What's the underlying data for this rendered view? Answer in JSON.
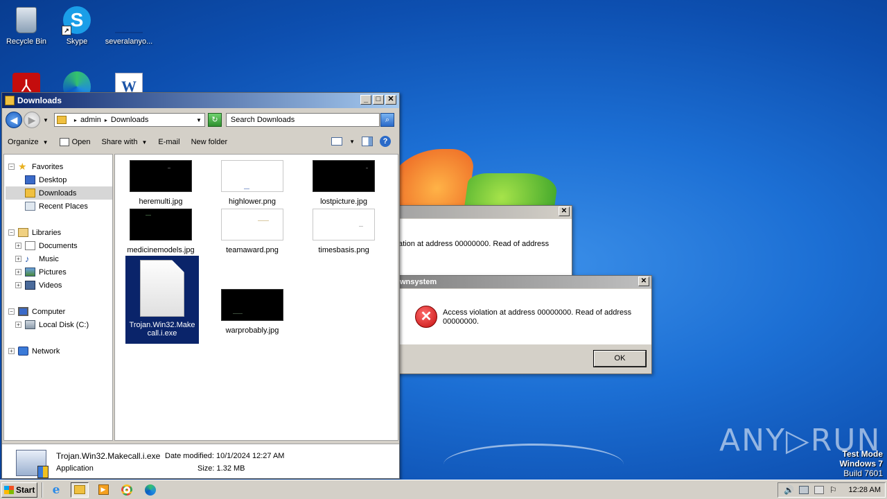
{
  "desktop": {
    "icons_row1": [
      {
        "label": "Recycle Bin",
        "icon": "recycle-bin-icon"
      },
      {
        "label": "Skype",
        "icon": "skype-icon"
      },
      {
        "label": "severalanyo...",
        "icon": "file-icon"
      }
    ],
    "icons_row2": [
      {
        "icon": "acrobat-icon"
      },
      {
        "icon": "edge-icon"
      },
      {
        "icon": "word-icon"
      }
    ],
    "watermark": "ANY▷RUN",
    "test_mode": {
      "line1": "Test Mode",
      "line2": "Windows 7",
      "line3": "Build 7601"
    }
  },
  "explorer": {
    "title": "Downloads",
    "breadcrumb": {
      "root": "admin",
      "current": "Downloads"
    },
    "search_placeholder": "Search Downloads",
    "toolbar": {
      "organize": "Organize",
      "open": "Open",
      "share_with": "Share with",
      "email": "E-mail",
      "new_folder": "New folder"
    },
    "nav": {
      "favorites": "Favorites",
      "desktop": "Desktop",
      "downloads": "Downloads",
      "recent_places": "Recent Places",
      "libraries": "Libraries",
      "documents": "Documents",
      "music": "Music",
      "pictures": "Pictures",
      "videos": "Videos",
      "computer": "Computer",
      "local_disk": "Local Disk (C:)",
      "network": "Network"
    },
    "files": [
      {
        "name": "heremulti.jpg",
        "thumb": "dark"
      },
      {
        "name": "highlower.png",
        "thumb": "light"
      },
      {
        "name": "lostpicture.jpg",
        "thumb": "dark"
      },
      {
        "name": "medicinemodels.jpg",
        "thumb": "dark"
      },
      {
        "name": "teamaward.png",
        "thumb": "light"
      },
      {
        "name": "timesbasis.png",
        "thumb": "light"
      },
      {
        "name": "Trojan.Win32.Makecall.i.exe",
        "name_line1": "Trojan.Win32.Make",
        "name_line2": "call.i.exe",
        "thumb": "document",
        "selected": true
      },
      {
        "name": "warprobably.jpg",
        "thumb": "dark"
      }
    ],
    "details": {
      "filename": "Trojan.Win32.Makecall.i.exe",
      "type": "Application",
      "date_label": "Date modified:",
      "date_value": "10/1/2024 12:27 AM",
      "size_label": "Size:",
      "size_value": "1.32 MB"
    }
  },
  "dialog_back": {
    "message": "ation at address 00000000. Read of address"
  },
  "dialog_front": {
    "title": "wnsystem",
    "message_line1": "Access violation at address 00000000. Read of address",
    "message_line2": "00000000.",
    "ok": "OK"
  },
  "taskbar": {
    "start": "Start",
    "apps": [
      "internet-explorer-icon",
      "explorer-folder-icon",
      "media-player-icon",
      "chrome-icon",
      "edge-icon"
    ],
    "clock": "12:28 AM"
  }
}
